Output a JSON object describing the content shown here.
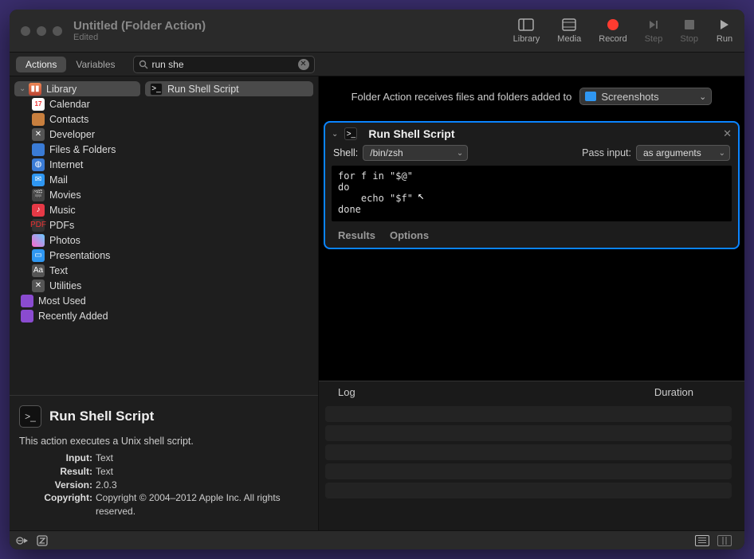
{
  "title": {
    "main": "Untitled (Folder Action)",
    "sub": "Edited"
  },
  "toolbar": {
    "library": "Library",
    "media": "Media",
    "record": "Record",
    "step": "Step",
    "stop": "Stop",
    "run": "Run"
  },
  "segments": {
    "actions": "Actions",
    "variables": "Variables"
  },
  "search": {
    "value": "run she"
  },
  "library": {
    "root": "Library",
    "items": [
      "Calendar",
      "Contacts",
      "Developer",
      "Files & Folders",
      "Internet",
      "Mail",
      "Movies",
      "Music",
      "PDFs",
      "Photos",
      "Presentations",
      "Text",
      "Utilities"
    ],
    "extras": [
      "Most Used",
      "Recently Added"
    ]
  },
  "results": {
    "item": "Run Shell Script"
  },
  "details": {
    "title": "Run Shell Script",
    "desc": "This action executes a Unix shell script.",
    "input_label": "Input:",
    "input_val": "Text",
    "result_label": "Result:",
    "result_val": "Text",
    "version_label": "Version:",
    "version_val": "2.0.3",
    "copyright_label": "Copyright:",
    "copyright_val": "Copyright © 2004–2012 Apple Inc. All rights reserved."
  },
  "receive": {
    "text": "Folder Action receives files and folders added to",
    "folder": "Screenshots"
  },
  "action": {
    "title": "Run Shell Script",
    "shell_label": "Shell:",
    "shell_value": "/bin/zsh",
    "passinput_label": "Pass input:",
    "passinput_value": "as arguments",
    "code": "for f in \"$@\"\ndo\n    echo \"$f\"\ndone",
    "results": "Results",
    "options": "Options"
  },
  "log": {
    "log_label": "Log",
    "duration_label": "Duration"
  }
}
